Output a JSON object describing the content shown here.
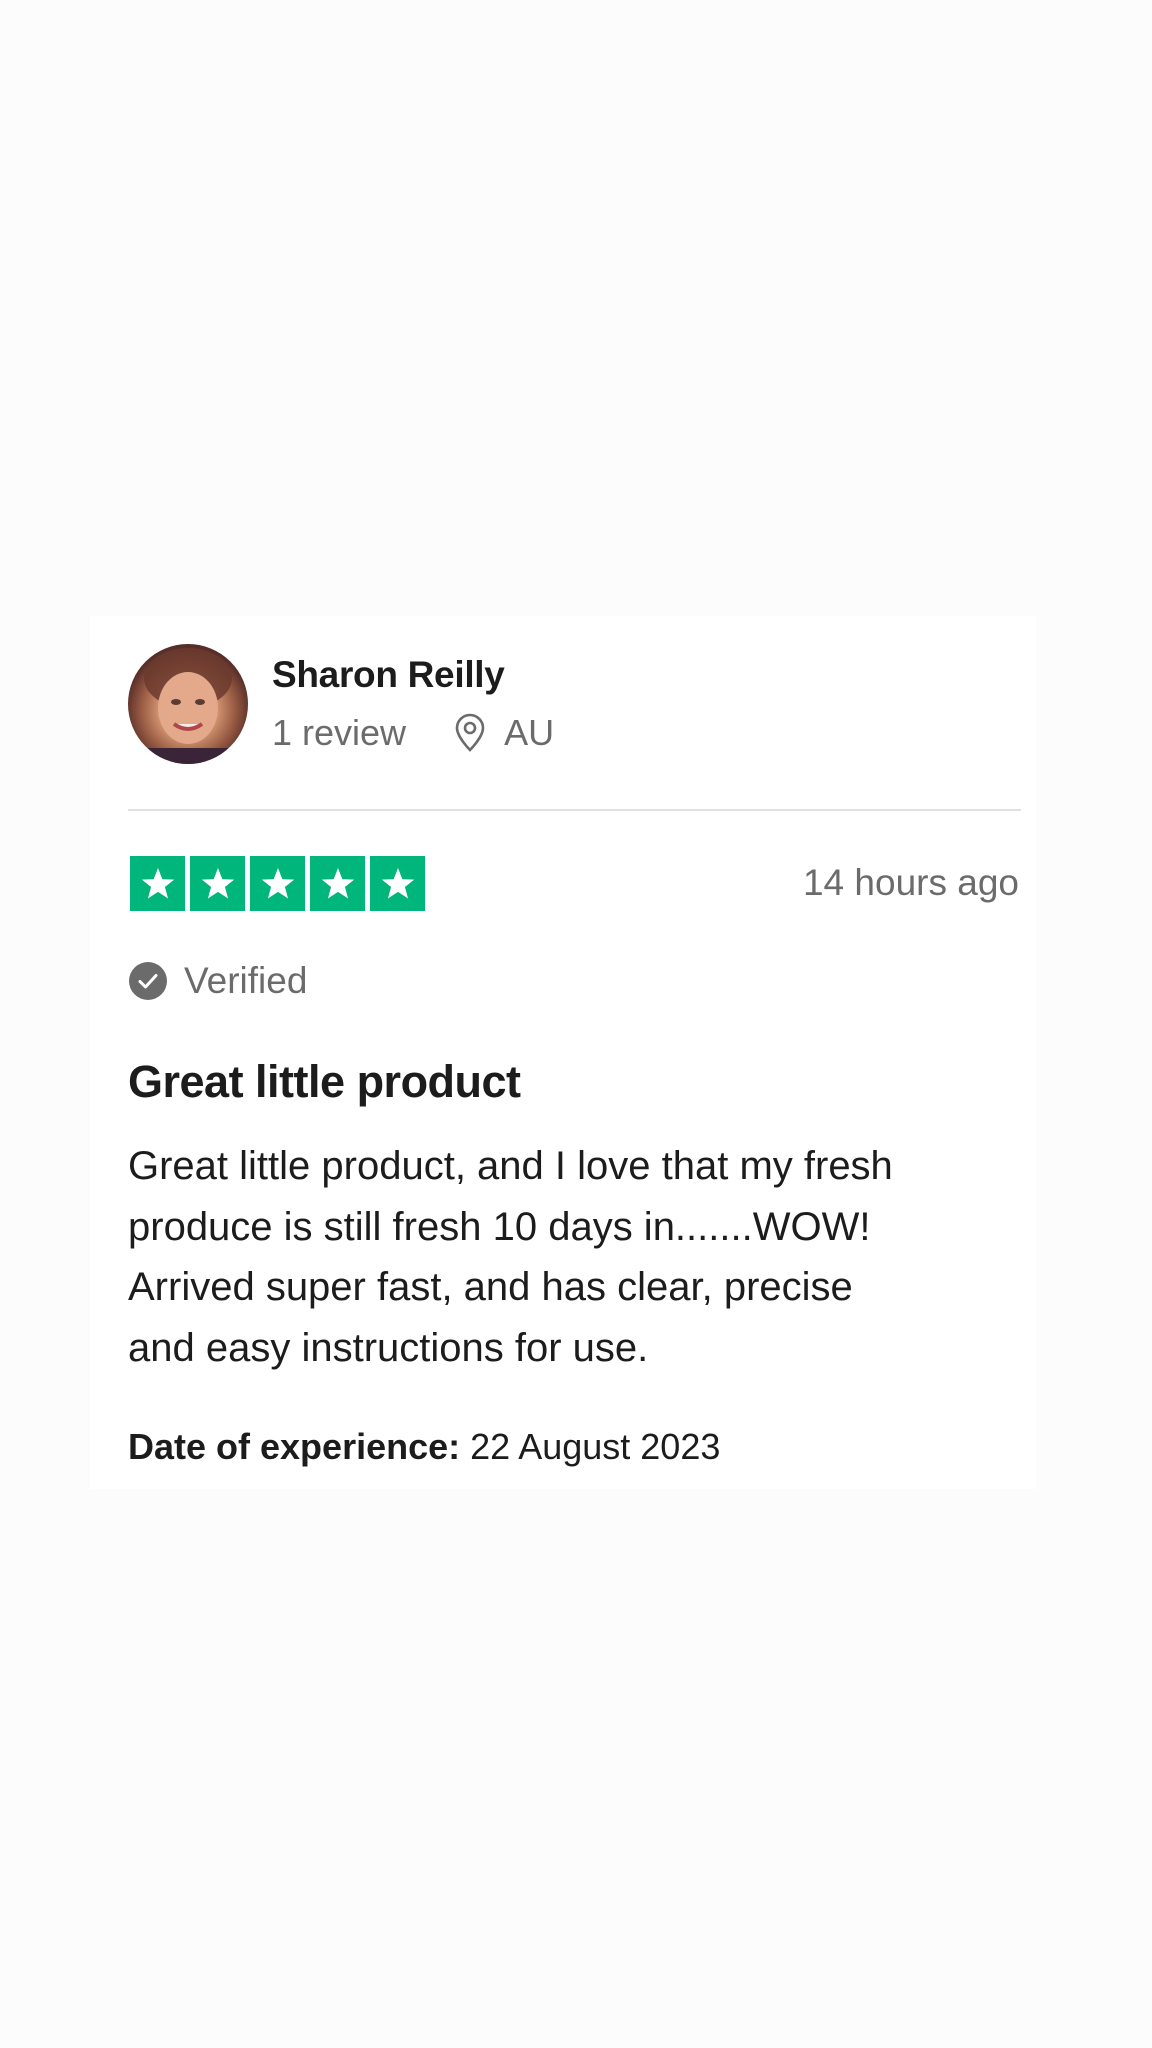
{
  "reviewer": {
    "name": "Sharon Reilly",
    "review_count": "1 review",
    "country": "AU",
    "avatar_icon": "profile-photo"
  },
  "rating": {
    "stars": 5,
    "max_stars": 5,
    "color": "#00b67a",
    "icon": "star-icon"
  },
  "timestamp": "14 hours ago",
  "verified": {
    "label": "Verified",
    "icon": "check-circle-icon"
  },
  "review": {
    "title": "Great little product",
    "body_lines": [
      "Great little product, and I love that my fresh",
      "produce is still fresh 10 days in.......WOW!",
      "Arrived super fast, and has clear, precise",
      "and easy instructions for use."
    ]
  },
  "date_of_experience": {
    "label": "Date of experience:",
    "value": "22 August 2023"
  }
}
